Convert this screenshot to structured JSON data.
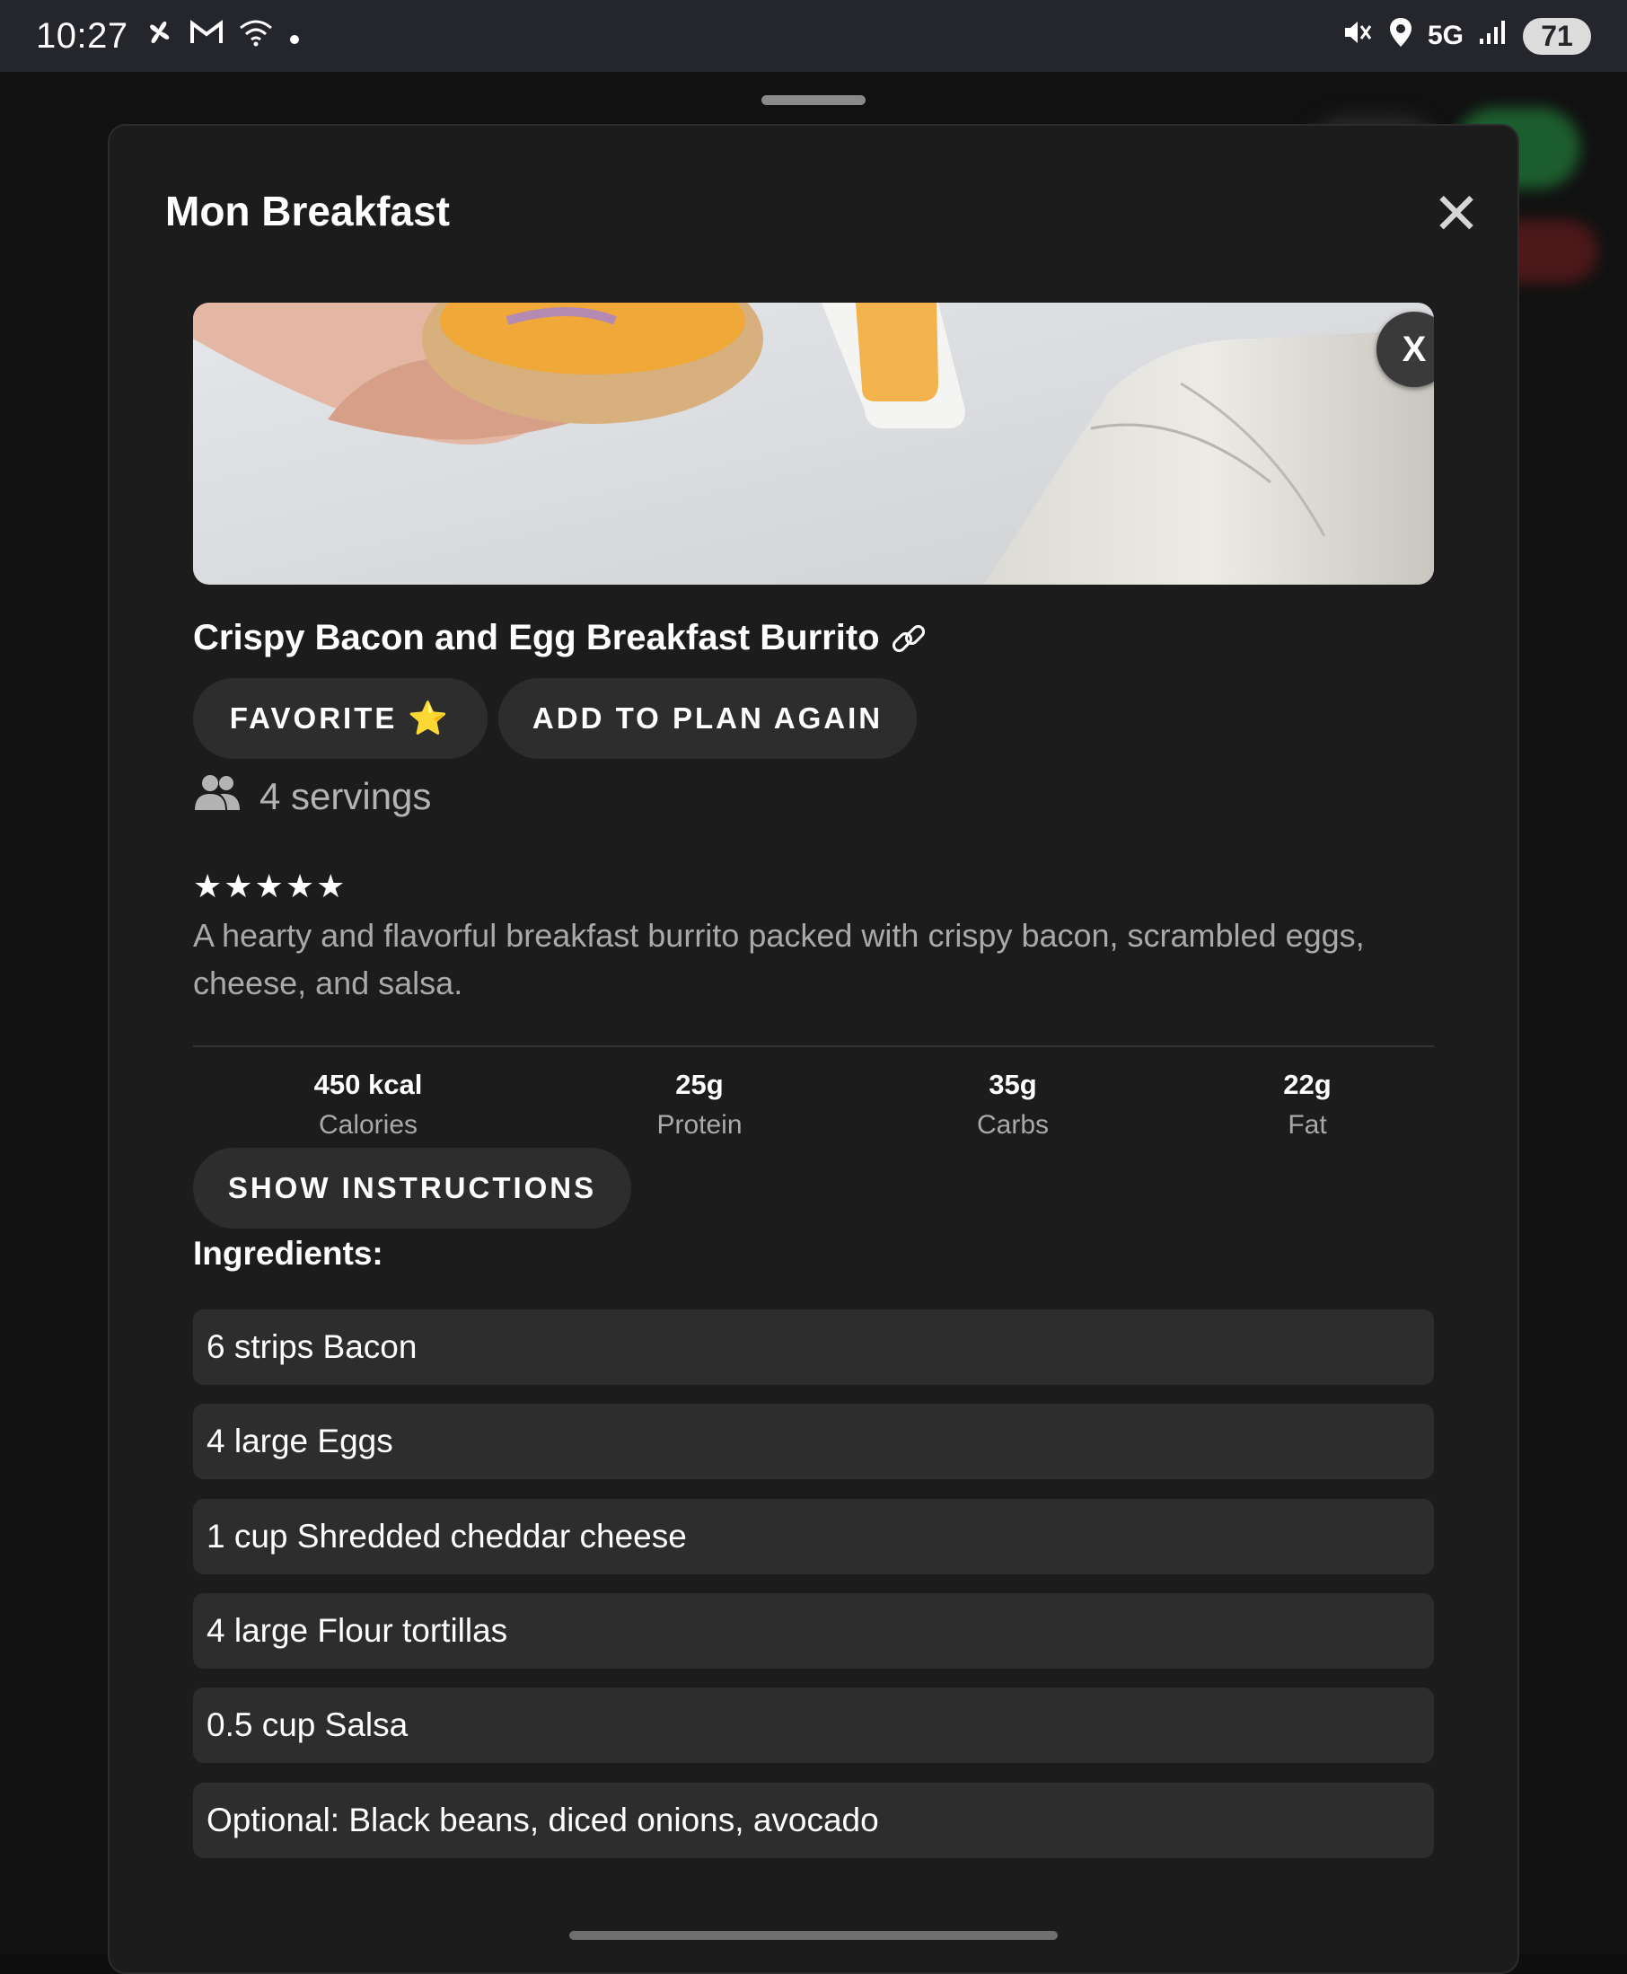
{
  "status_bar": {
    "time": "10:27",
    "network": "5G",
    "battery": "71",
    "left_icons": [
      "pinwheel-icon",
      "gmail-icon",
      "wifi-icon",
      "dot-icon"
    ],
    "right_icons": [
      "mute-icon",
      "location-icon",
      "5g-icon",
      "signal-icon"
    ]
  },
  "sheet": {
    "title": "Mon Breakfast",
    "close_icon": "close-icon"
  },
  "recipe": {
    "title": "Crispy Bacon and Egg Breakfast Burrito",
    "image_close_label": "X",
    "favorite_label": "FAVORITE",
    "favorite_emoji": "⭐",
    "add_to_plan_label": "ADD TO PLAN AGAIN",
    "servings": "4 servings",
    "rating_text": "★★★★★",
    "rating": 5,
    "description": "A hearty and flavorful breakfast burrito packed with crispy bacon, scrambled eggs, cheese, and salsa.",
    "macros": [
      {
        "value": "450 kcal",
        "label": "Calories"
      },
      {
        "value": "25g",
        "label": "Protein"
      },
      {
        "value": "35g",
        "label": "Carbs"
      },
      {
        "value": "22g",
        "label": "Fat"
      }
    ],
    "show_instructions_label": "SHOW INSTRUCTIONS",
    "ingredients_heading": "Ingredients:",
    "ingredients": [
      "6 strips Bacon",
      "4 large Eggs",
      "1 cup Shredded cheddar cheese",
      "4 large Flour tortillas",
      "0.5 cup Salsa",
      "Optional: Black beans, diced onions, avocado"
    ]
  },
  "colors": {
    "sheet_bg": "#1c1c1c",
    "pill_bg": "#2d2d2d",
    "text_primary": "#ffffff",
    "text_secondary": "#a9a9a9",
    "star": "#f6c31a"
  }
}
